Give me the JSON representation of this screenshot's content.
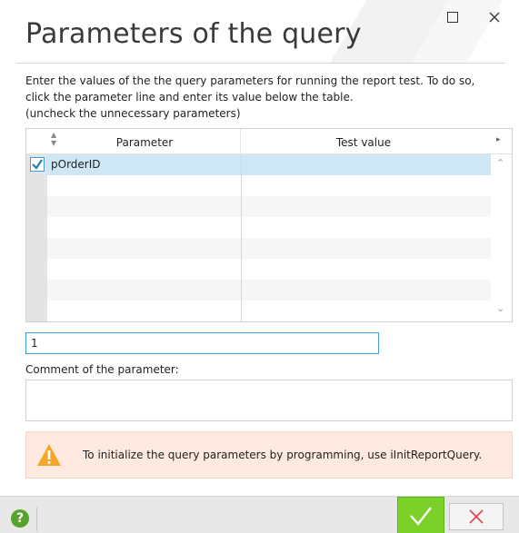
{
  "window": {
    "title": "Parameters of the query"
  },
  "description": {
    "line1": "Enter the values of the the query parameters for running the report test. To do so,",
    "line2": "click the parameter line and enter its value below the table.",
    "line3": "(uncheck the unnecessary parameters)"
  },
  "grid": {
    "columns": [
      "Parameter",
      "Test value"
    ],
    "rows": [
      {
        "checked": true,
        "parameter": "pOrderID",
        "test_value": ""
      }
    ]
  },
  "value_input": {
    "value": "1"
  },
  "comment": {
    "label": "Comment of the parameter:",
    "value": ""
  },
  "warning": {
    "text": "To initialize the query parameters by programming, use iInitReportQuery."
  },
  "footer": {
    "help_label": "?"
  },
  "colors": {
    "accent": "#3c9fd6",
    "ok_green": "#7bd128",
    "cancel_red": "#e0434a",
    "warning_bg": "#fde9df",
    "warning_icon": "#f4a72a",
    "selected_row": "#cfe7f5"
  },
  "icons": {
    "maximize": "maximize-icon",
    "close": "close-icon",
    "checkbox": "checkbox-checked-icon",
    "warning": "warning-triangle-icon",
    "help": "help-circle-icon",
    "ok": "checkmark-icon",
    "cancel": "cross-icon"
  }
}
